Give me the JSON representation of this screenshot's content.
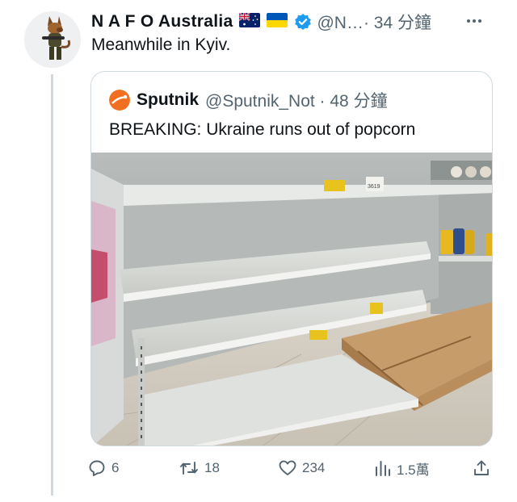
{
  "tweet": {
    "display_name": "N A F O Australia",
    "handle_time": "@N…· 34 分鐘",
    "text": "Meanwhile in Kyiv.",
    "avatar_icon": "avatar-dog-soldier-icon",
    "flags": [
      "australia-flag-icon",
      "ukraine-flag-icon"
    ],
    "verified_color": "#1d9bf0"
  },
  "quote": {
    "name": "Sputnik",
    "handle_time": "@Sputnik_Not · 48 分鐘",
    "text": "BREAKING: Ukraine runs out of popcorn",
    "logo_icon": "sputnik-logo-icon",
    "media_alt": "empty supermarket shelves",
    "price_tag": "3619"
  },
  "actions": {
    "replies": "6",
    "retweets": "18",
    "likes": "234",
    "views": "1.5萬"
  },
  "colors": {
    "text": "#0f1419",
    "secondary": "#536471",
    "border": "#cfd9de",
    "accent": "#1d9bf0"
  }
}
